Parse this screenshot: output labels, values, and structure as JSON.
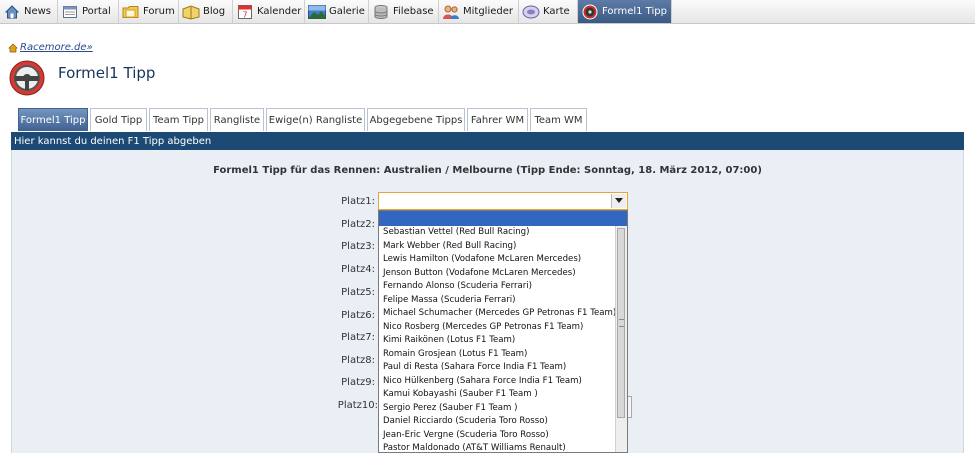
{
  "nav": [
    {
      "label": "News",
      "icon": "home-icon"
    },
    {
      "label": "Portal",
      "icon": "portal-icon"
    },
    {
      "label": "Forum",
      "icon": "folder-icon"
    },
    {
      "label": "Blog",
      "icon": "blog-icon"
    },
    {
      "label": "Kalender",
      "icon": "calendar-icon"
    },
    {
      "label": "Galerie",
      "icon": "gallery-icon"
    },
    {
      "label": "Filebase",
      "icon": "database-icon"
    },
    {
      "label": "Mitglieder",
      "icon": "members-icon"
    },
    {
      "label": "Karte",
      "icon": "map-icon"
    },
    {
      "label": "Formel1 Tipp",
      "icon": "steering-wheel-icon"
    }
  ],
  "header": {
    "brand": "Racemore.de»",
    "title": "Formel1 Tipp"
  },
  "tabs": [
    {
      "label": "Formel1 Tipp"
    },
    {
      "label": "Gold Tipp"
    },
    {
      "label": "Team Tipp"
    },
    {
      "label": "Rangliste"
    },
    {
      "label": "Ewige(n) Rangliste"
    },
    {
      "label": "Abgegebene Tipps"
    },
    {
      "label": "Fahrer WM"
    },
    {
      "label": "Team WM"
    }
  ],
  "subheader": "Hier kannst du deinen F1 Tipp abgeben",
  "race_heading": "Formel1 Tipp für das Rennen: Australien / Melbourne (Tipp Ende: Sonntag, 18. März 2012, 07:00)",
  "platz_labels": [
    "Platz1:",
    "Platz2:",
    "Platz3:",
    "Platz4:",
    "Platz5:",
    "Platz6:",
    "Platz7:",
    "Platz8:",
    "Platz9:",
    "Platz10:"
  ],
  "dropdown": {
    "selected": "",
    "options": [
      "Sebastian Vettel (Red Bull Racing)",
      "Mark Webber (Red Bull Racing)",
      "Lewis Hamilton (Vodafone McLaren Mercedes)",
      "Jenson Button (Vodafone McLaren Mercedes)",
      "Fernando Alonso (Scuderia Ferrari)",
      "Felipe Massa (Scuderia Ferrari)",
      "Michael Schumacher (Mercedes GP Petronas F1 Team)",
      "Nico Rosberg (Mercedes GP Petronas F1 Team)",
      "Kimi Raikönen (Lotus F1 Team)",
      "Romain Grosjean (Lotus F1 Team)",
      "Paul di Resta (Sahara Force India F1 Team)",
      "Nico Hülkenberg (Sahara Force India F1 Team)",
      "Kamui Kobayashi (Sauber F1 Team )",
      "Sergio Perez (Sauber F1 Team )",
      "Daniel Ricciardo (Scuderia Toro Rosso)",
      "Jean-Eric Vergne (Scuderia Toro Rosso)",
      "Pastor Maldonado (AT&T Williams Renault)"
    ]
  }
}
